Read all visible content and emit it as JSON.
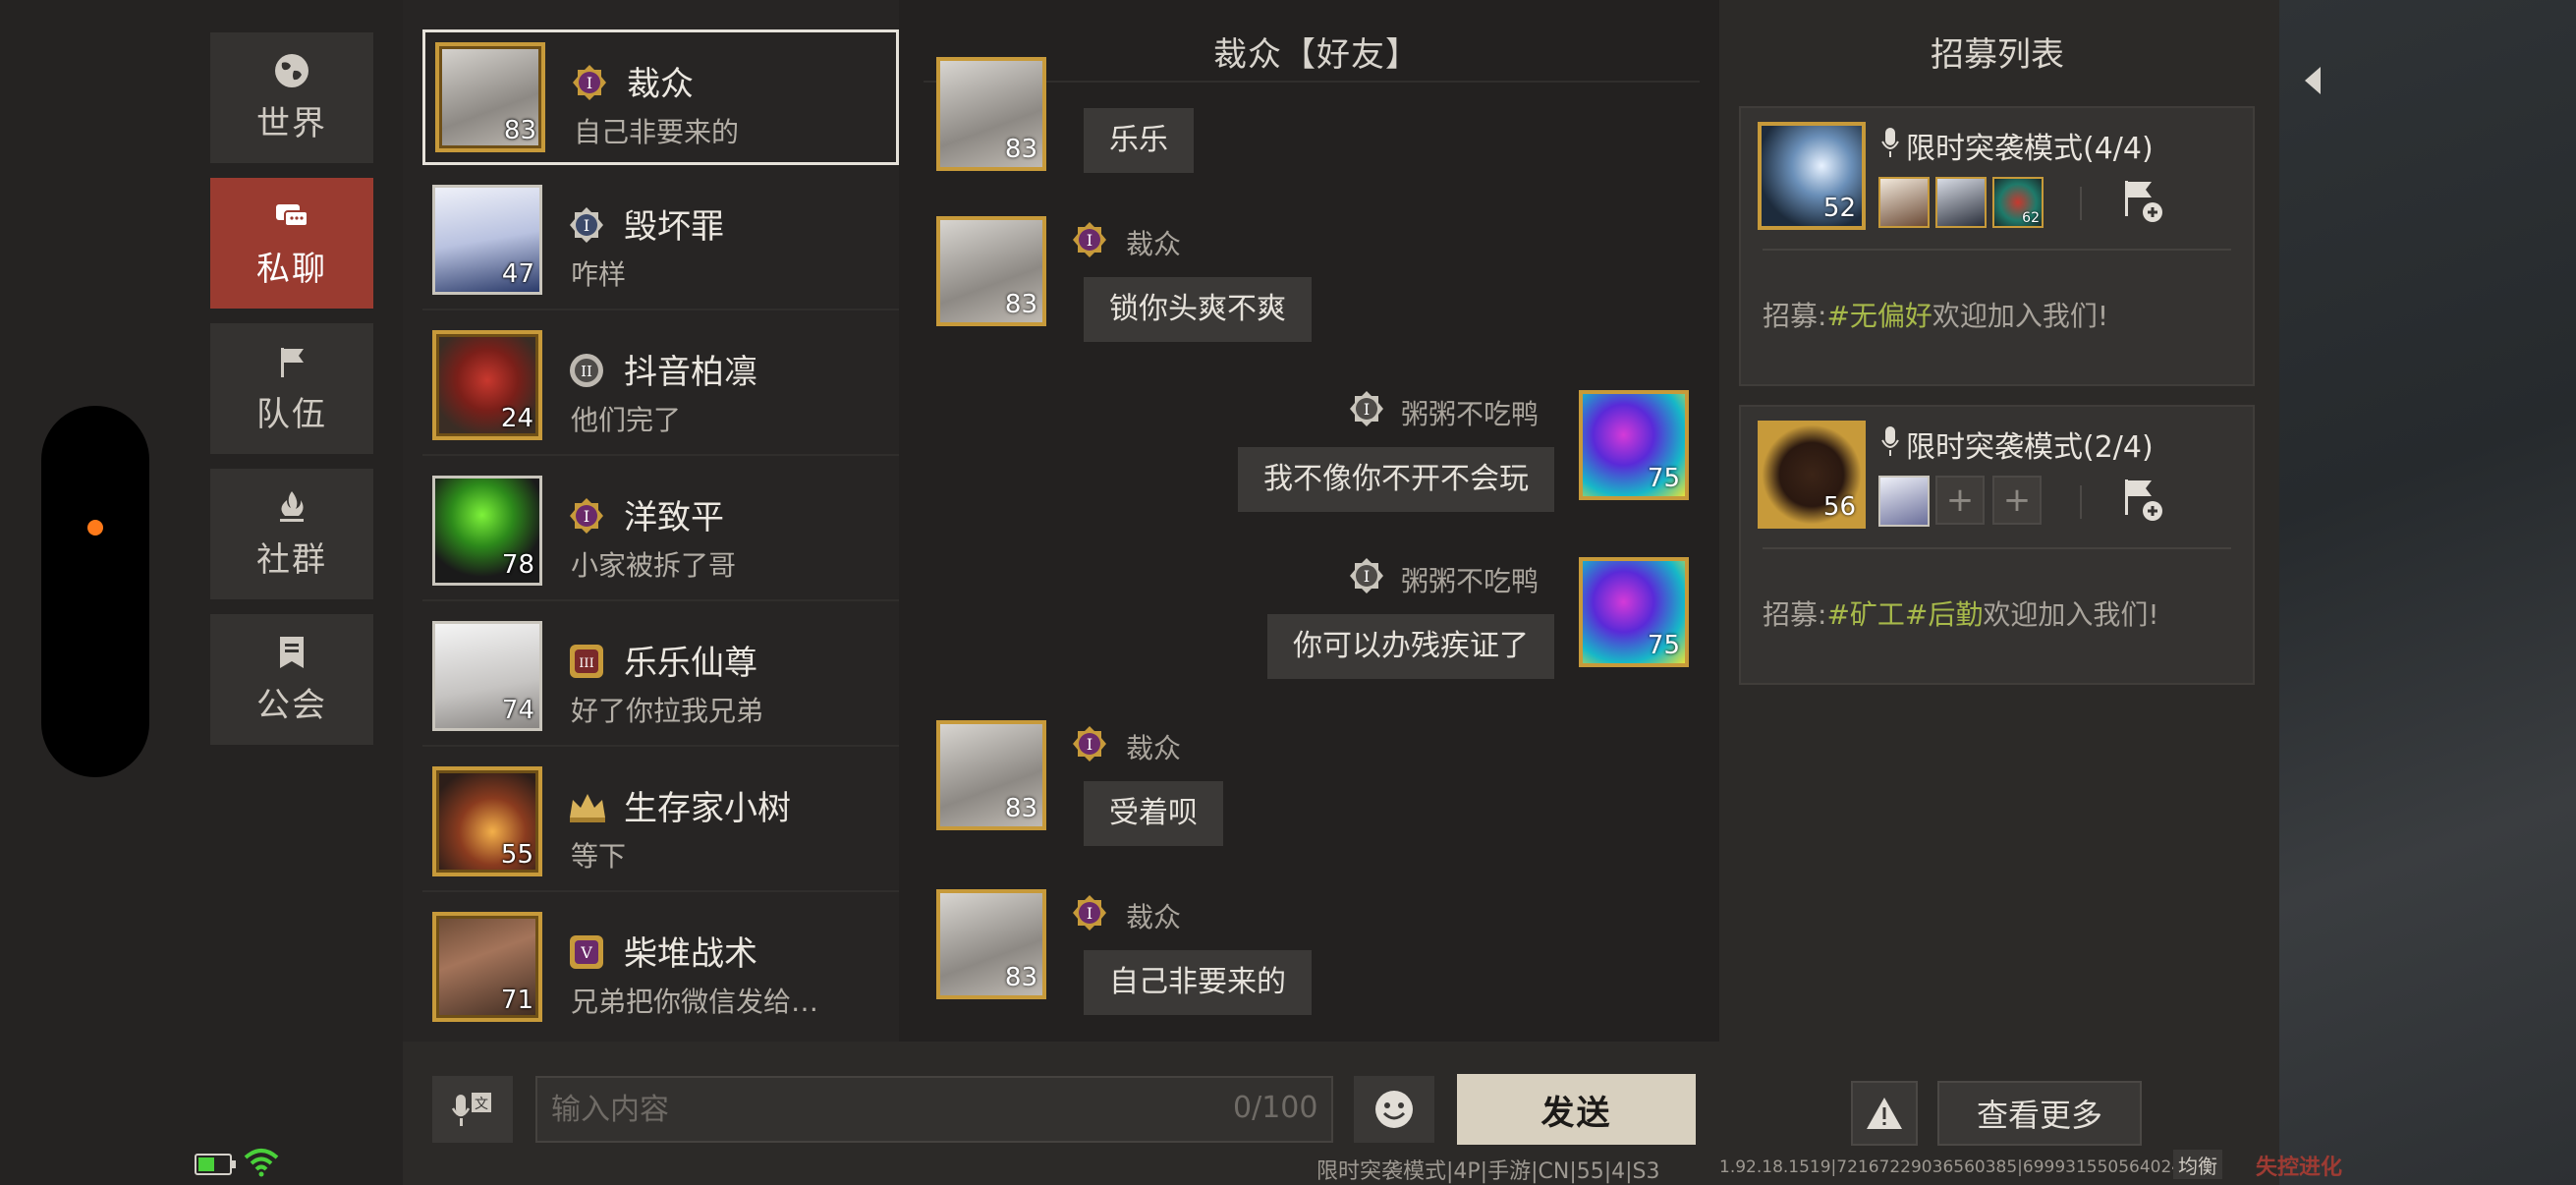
{
  "nav": {
    "items": [
      {
        "label": "世界",
        "icon": "globe-icon"
      },
      {
        "label": "私聊",
        "icon": "chat-bubbles-icon"
      },
      {
        "label": "队伍",
        "icon": "flag-icon"
      },
      {
        "label": "社群",
        "icon": "campfire-icon"
      },
      {
        "label": "公会",
        "icon": "guild-banner-icon"
      }
    ],
    "active": "私聊"
  },
  "conversations": [
    {
      "name": "裁众",
      "message": "自己非要来的",
      "level": "83",
      "rank": "I",
      "selected": true
    },
    {
      "name": "毁坏罪",
      "message": "咋样",
      "level": "47",
      "rank": "I"
    },
    {
      "name": "抖音柏凛",
      "message": "他们完了",
      "level": "24",
      "rank": "II"
    },
    {
      "name": "洋致平",
      "message": "小家被拆了哥",
      "level": "78",
      "rank": "I"
    },
    {
      "name": "乐乐仙尊",
      "message": "好了你拉我兄弟",
      "level": "74",
      "rank": "III"
    },
    {
      "name": "生存家小树",
      "message": "等下",
      "level": "55",
      "rank": "crown"
    },
    {
      "name": "柴堆战术",
      "message": "兄弟把你微信发给…",
      "level": "71",
      "rank": "V"
    }
  ],
  "chat": {
    "title": "裁众【好友】",
    "messages": [
      {
        "side": "left",
        "sender": "",
        "text": "乐乐",
        "level": "83"
      },
      {
        "side": "left",
        "sender": "裁众",
        "text": "锁你头爽不爽",
        "level": "83"
      },
      {
        "side": "right",
        "sender": "粥粥不吃鸭",
        "text": "我不像你不开不会玩",
        "level": "75"
      },
      {
        "side": "right",
        "sender": "粥粥不吃鸭",
        "text": "你可以办残疾证了",
        "level": "75"
      },
      {
        "side": "left",
        "sender": "裁众",
        "text": "受着呗",
        "level": "83"
      },
      {
        "side": "left",
        "sender": "裁众",
        "text": "自己非要来的",
        "level": "83"
      }
    ],
    "input": {
      "placeholder": "输入内容",
      "counter": "0/100",
      "send_label": "发送"
    }
  },
  "recruit": {
    "title": "招募列表",
    "cards": [
      {
        "mode": "限时突袭模式(4/4)",
        "host_level": "52",
        "member_levels": [
          "",
          "",
          "62"
        ],
        "text_prefix": "招募:",
        "tags": "#无偏好",
        "text_suffix": "欢迎加入我们!"
      },
      {
        "mode": "限时突袭模式(2/4)",
        "host_level": "56",
        "member_levels": [
          ""
        ],
        "text_prefix": "招募:",
        "tags": "#矿工#后勤",
        "text_suffix": "欢迎加入我们!"
      }
    ],
    "more_label": "查看更多"
  },
  "status": {
    "mode_info": "限时突袭模式|4P|手游|CN|55|4|S3",
    "build": "1.92.18.1519|72167229036560385|69993155056402433",
    "balance": "均衡",
    "logo": "失控进化"
  },
  "colors": {
    "accent": "#9a3b30",
    "gold": "#c79a3a",
    "tag": "#a7b94a",
    "capsule_dot": "#ff7a1a"
  }
}
